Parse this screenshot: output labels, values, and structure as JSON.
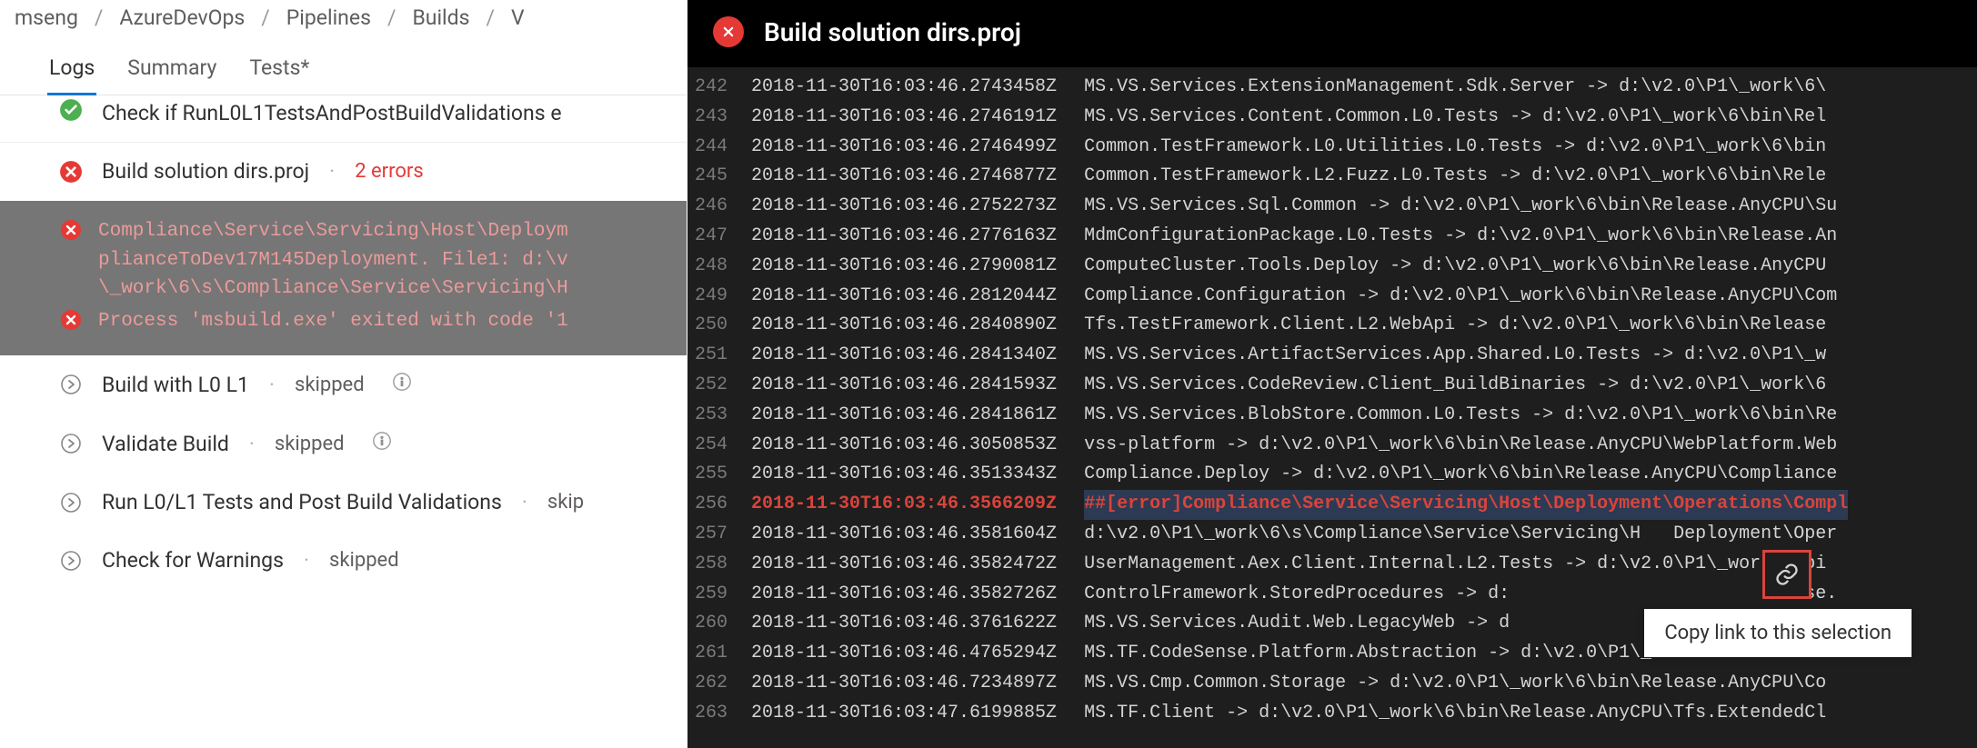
{
  "breadcrumb": [
    "mseng",
    "AzureDevOps",
    "Pipelines",
    "Builds",
    "V"
  ],
  "tabs": {
    "logs": "Logs",
    "summary": "Summary",
    "tests": "Tests*"
  },
  "left": {
    "step0_name": "Check if RunL0L1TestsAndPostBuildValidations e",
    "step1_name": "Build solution dirs.proj",
    "step1_err": "2 errors",
    "err1": "Compliance\\Service\\Servicing\\Host\\Deploym\nplianceToDev17M145Deployment. File1: d:\\v\n\\_work\\6\\s\\Compliance\\Service\\Servicing\\H",
    "err2": "Process 'msbuild.exe' exited with code '1",
    "step2_name": "Build with L0 L1",
    "step3_name": "Validate Build",
    "step4_name": "Run L0/L1 Tests and Post Build Validations",
    "step5_name": "Check for Warnings",
    "skipped": "skipped",
    "skip": "skip"
  },
  "log_header": "Build solution dirs.proj",
  "copy_tooltip": "Copy link to this selection",
  "log_lines": [
    {
      "n": 242,
      "ts": "2018-11-30T16:03:46.2743458Z",
      "msg": "MS.VS.Services.ExtensionManagement.Sdk.Server -> d:\\v2.0\\P1\\_work\\6\\"
    },
    {
      "n": 243,
      "ts": "2018-11-30T16:03:46.2746191Z",
      "msg": "MS.VS.Services.Content.Common.L0.Tests -> d:\\v2.0\\P1\\_work\\6\\bin\\Rel"
    },
    {
      "n": 244,
      "ts": "2018-11-30T16:03:46.2746499Z",
      "msg": "Common.TestFramework.L0.Utilities.L0.Tests -> d:\\v2.0\\P1\\_work\\6\\bin"
    },
    {
      "n": 245,
      "ts": "2018-11-30T16:03:46.2746877Z",
      "msg": "Common.TestFramework.L2.Fuzz.L0.Tests -> d:\\v2.0\\P1\\_work\\6\\bin\\Rele"
    },
    {
      "n": 246,
      "ts": "2018-11-30T16:03:46.2752273Z",
      "msg": "MS.VS.Services.Sql.Common -> d:\\v2.0\\P1\\_work\\6\\bin\\Release.AnyCPU\\Su"
    },
    {
      "n": 247,
      "ts": "2018-11-30T16:03:46.2776163Z",
      "msg": "MdmConfigurationPackage.L0.Tests -> d:\\v2.0\\P1\\_work\\6\\bin\\Release.An"
    },
    {
      "n": 248,
      "ts": "2018-11-30T16:03:46.2790081Z",
      "msg": "ComputeCluster.Tools.Deploy -> d:\\v2.0\\P1\\_work\\6\\bin\\Release.AnyCPU"
    },
    {
      "n": 249,
      "ts": "2018-11-30T16:03:46.2812044Z",
      "msg": "Compliance.Configuration -> d:\\v2.0\\P1\\_work\\6\\bin\\Release.AnyCPU\\Com"
    },
    {
      "n": 250,
      "ts": "2018-11-30T16:03:46.2840890Z",
      "msg": "Tfs.TestFramework.Client.L2.WebApi -> d:\\v2.0\\P1\\_work\\6\\bin\\Release"
    },
    {
      "n": 251,
      "ts": "2018-11-30T16:03:46.2841340Z",
      "msg": "MS.VS.Services.ArtifactServices.App.Shared.L0.Tests -> d:\\v2.0\\P1\\_w"
    },
    {
      "n": 252,
      "ts": "2018-11-30T16:03:46.2841593Z",
      "msg": "MS.VS.Services.CodeReview.Client_BuildBinaries -> d:\\v2.0\\P1\\_work\\6"
    },
    {
      "n": 253,
      "ts": "2018-11-30T16:03:46.2841861Z",
      "msg": "MS.VS.Services.BlobStore.Common.L0.Tests -> d:\\v2.0\\P1\\_work\\6\\bin\\Re"
    },
    {
      "n": 254,
      "ts": "2018-11-30T16:03:46.3050853Z",
      "msg": "vss-platform -> d:\\v2.0\\P1\\_work\\6\\bin\\Release.AnyCPU\\WebPlatform.Web"
    },
    {
      "n": 255,
      "ts": "2018-11-30T16:03:46.3513343Z",
      "msg": "Compliance.Deploy -> d:\\v2.0\\P1\\_work\\6\\bin\\Release.AnyCPU\\Compliance"
    },
    {
      "n": 256,
      "ts": "2018-11-30T16:03:46.3566209Z",
      "msg": "##[error]Compliance\\Service\\Servicing\\Host\\Deployment\\Operations\\Compl",
      "err": true
    },
    {
      "n": 257,
      "ts": "2018-11-30T16:03:46.3581604Z",
      "msg": "d:\\v2.0\\P1\\_work\\6\\s\\Compliance\\Service\\Servicing\\H   Deployment\\Oper"
    },
    {
      "n": 258,
      "ts": "2018-11-30T16:03:46.3582472Z",
      "msg": "UserManagement.Aex.Client.Internal.L2.Tests -> d:\\v2.0\\P1\\_work\\6\\bi"
    },
    {
      "n": 259,
      "ts": "2018-11-30T16:03:46.3582726Z",
      "msg": "ControlFramework.StoredProcedures -> d:                        lease."
    },
    {
      "n": 260,
      "ts": "2018-11-30T16:03:46.3761622Z",
      "msg": "MS.VS.Services.Audit.Web.LegacyWeb -> d                        lease."
    },
    {
      "n": 261,
      "ts": "2018-11-30T16:03:46.4765294Z",
      "msg": "MS.TF.CodeSense.Platform.Abstraction -> d:\\v2.0\\P1\\_work\\6\\bin\\Relea"
    },
    {
      "n": 262,
      "ts": "2018-11-30T16:03:46.7234897Z",
      "msg": "MS.VS.Cmp.Common.Storage -> d:\\v2.0\\P1\\_work\\6\\bin\\Release.AnyCPU\\Co"
    },
    {
      "n": 263,
      "ts": "2018-11-30T16:03:47.6199885Z",
      "msg": "MS.TF.Client -> d:\\v2.0\\P1\\_work\\6\\bin\\Release.AnyCPU\\Tfs.ExtendedCl"
    }
  ]
}
